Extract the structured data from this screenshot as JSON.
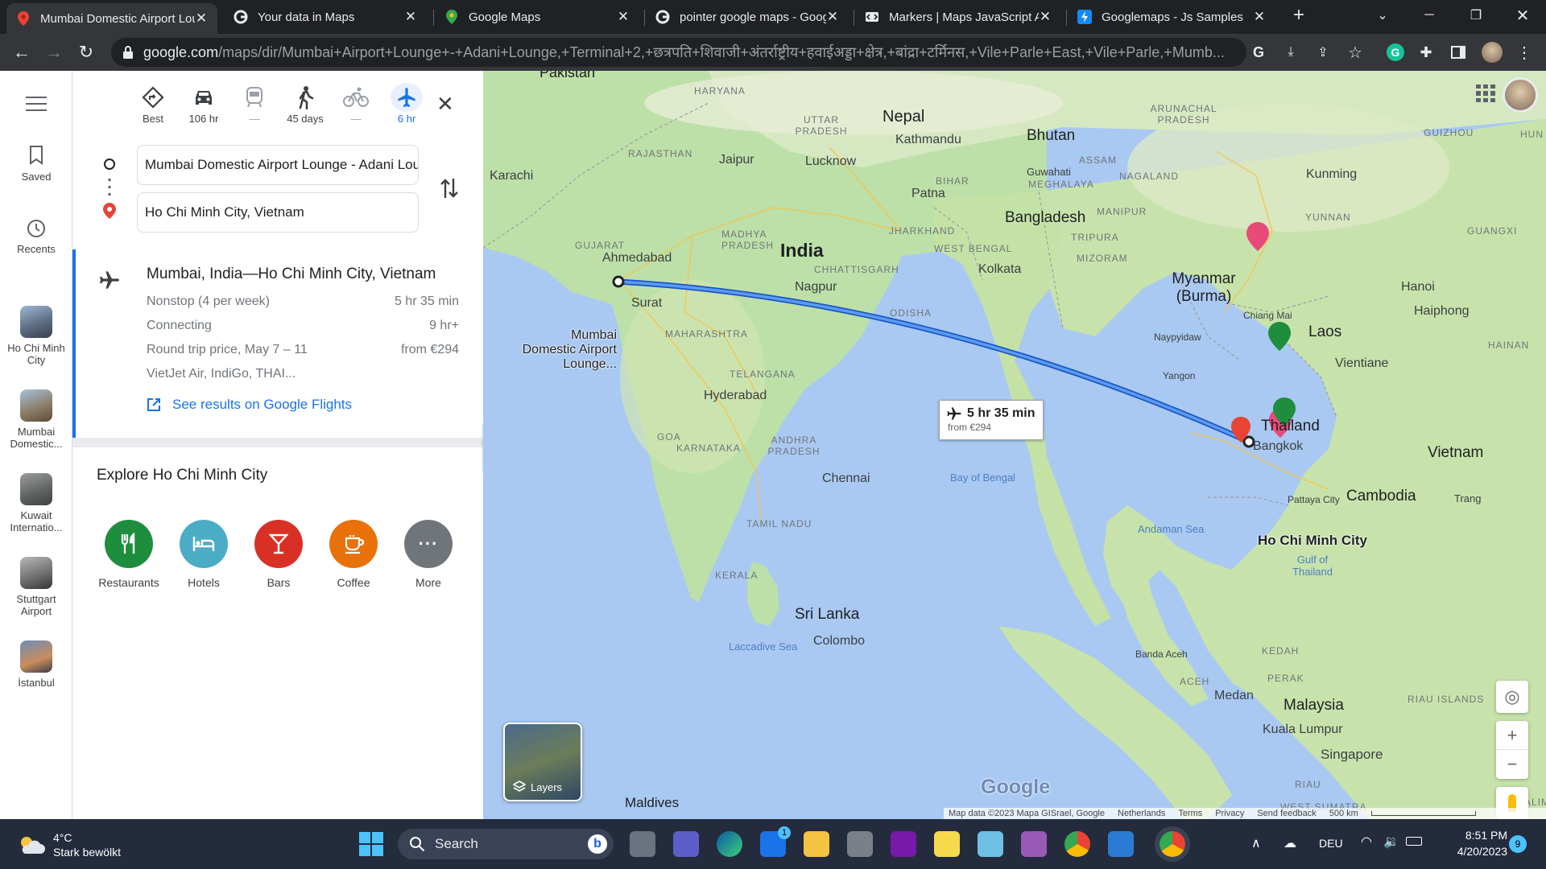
{
  "browser": {
    "tabs": [
      {
        "title": "Mumbai Domestic Airport Lounge - Adani",
        "icon": "google-maps-icon",
        "active": true
      },
      {
        "title": "Your data in Maps",
        "icon": "google-icon",
        "active": false
      },
      {
        "title": "Google Maps",
        "icon": "google-maps-icon",
        "active": false
      },
      {
        "title": "pointer google maps - Google Search",
        "icon": "google-icon",
        "active": false
      },
      {
        "title": "Markers | Maps JavaScript API",
        "icon": "google-dev-icon",
        "active": false
      },
      {
        "title": "Googlemaps - Js Samples",
        "icon": "bolt-icon",
        "active": false
      }
    ],
    "new_tab": "+",
    "url_host": "google.com",
    "url_path": "/maps/dir/Mumbai+Airport+Lounge+-+Adani+Lounge,+Terminal+2,+छत्रपति+शिवाजी+अंतर्राष्ट्रीय+हवाईअड्डा+क्षेत्र,+बांद्रा+टर्मिनस,+Vile+Parle+East,+Vile+Parle,+Mumb..."
  },
  "rail": {
    "items": [
      {
        "label": "Saved",
        "icon": "bookmark-icon"
      },
      {
        "label": "Recents",
        "icon": "history-icon"
      },
      {
        "label": "Ho Chi Minh City",
        "icon": "place-thumbnail"
      },
      {
        "label": "Mumbai Domestic...",
        "icon": "place-thumbnail"
      },
      {
        "label": "Kuwait Internatio...",
        "icon": "place-thumbnail"
      },
      {
        "label": "Stuttgart Airport",
        "icon": "place-thumbnail"
      },
      {
        "label": "İstanbul",
        "icon": "place-thumbnail"
      }
    ]
  },
  "directions": {
    "modes": [
      {
        "label": "Best",
        "icon": "best-route-icon"
      },
      {
        "label": "106 hr",
        "icon": "car-icon"
      },
      {
        "label": "—",
        "icon": "transit-icon"
      },
      {
        "label": "45 days",
        "icon": "walk-icon"
      },
      {
        "label": "—",
        "icon": "bike-icon"
      },
      {
        "label": "6 hr",
        "icon": "flight-icon"
      }
    ],
    "origin": "Mumbai Domestic Airport Lounge - Adani Lounge",
    "destination": "Ho Chi Minh City, Vietnam"
  },
  "flight_result": {
    "title": "Mumbai, India—Ho Chi Minh City, Vietnam",
    "rows": [
      {
        "label": "Nonstop (4 per week)",
        "value": "5 hr 35 min"
      },
      {
        "label": "Connecting",
        "value": "9 hr+"
      },
      {
        "label": "Round trip price, May 7 – 11",
        "value": "from €294"
      }
    ],
    "airlines": "VietJet Air, IndiGo, THAI...",
    "link": "See results on Google Flights"
  },
  "explore": {
    "title": "Explore Ho Chi Minh City",
    "categories": [
      {
        "label": "Restaurants",
        "color": "#1e8e3e",
        "icon": "fork-knife-icon"
      },
      {
        "label": "Hotels",
        "color": "#4bacc6",
        "icon": "bed-icon"
      },
      {
        "label": "Bars",
        "color": "#d93025",
        "icon": "cocktail-icon"
      },
      {
        "label": "Coffee",
        "color": "#e8710a",
        "icon": "coffee-icon"
      },
      {
        "label": "More",
        "color": "#70757a",
        "icon": "more-dots-icon"
      }
    ]
  },
  "map": {
    "flight_badge": {
      "duration": "5 hr 35 min",
      "price": "from €294"
    },
    "origin_label": "Mumbai Domestic Airport Lounge...",
    "destination_label": "Ho Chi Minh City",
    "countries": [
      "Pakistan",
      "Nepal",
      "Bhutan",
      "India",
      "Bangladesh",
      "Myanmar (Burma)",
      "Laos",
      "Thailand",
      "Vietnam",
      "Cambodia",
      "Sri Lanka",
      "Malaysia",
      "Maldives"
    ],
    "cities": [
      "Karachi",
      "Jaipur",
      "Lucknow",
      "Kathmandu",
      "Patna",
      "Ahmedabad",
      "Surat",
      "Nagpur",
      "Kolkata",
      "Hyderabad",
      "Chennai",
      "Colombo",
      "Kunming",
      "Hanoi",
      "Haiphong",
      "Vientiane",
      "Bangkok",
      "Yangon",
      "Naypyidaw",
      "Chiang Mai",
      "Pattaya City",
      "Trang",
      "Medan",
      "Kuala Lumpur",
      "Singapore",
      "Guwahati",
      "Banda Aceh"
    ],
    "regions": [
      "HARYANA",
      "UTTAR PRADESH",
      "RAJASTHAN",
      "BIHAR",
      "ARUNACHAL PRADESH",
      "ASSAM",
      "MEGHALAYA",
      "NAGALAND",
      "MANIPUR",
      "TRIPURA",
      "MIZORAM",
      "JHARKHAND",
      "WEST BENGAL",
      "GUJARAT",
      "MADHYA PRADESH",
      "CHHATTISGARH",
      "ODISHA",
      "MAHARASHTRA",
      "TELANGANA",
      "GOA",
      "KARNATAKA",
      "ANDHRA PRADESH",
      "TAMIL NADU",
      "KERALA",
      "YUNNAN",
      "GUIZHOU",
      "GUANGXI",
      "HAINAN",
      "KEDAH",
      "PERAK",
      "ACEH",
      "RIAU",
      "RIAU ISLANDS",
      "WEST SUMATRA",
      "HUN",
      "KALIMAN"
    ],
    "water": [
      "Bay of Bengal",
      "Andaman Sea",
      "Gulf of Thailand",
      "Laccadive Sea"
    ],
    "layers": "Layers",
    "logo": "Google",
    "attribution": [
      "Map data ©2023 Mapa GISrael, Google",
      "Netherlands",
      "Terms",
      "Privacy",
      "Send feedback",
      "500 km"
    ]
  },
  "taskbar": {
    "weather_temp": "4°C",
    "weather_desc": "Stark bewölkt",
    "search": "Search",
    "lang": "DEU",
    "time": "8:51 PM",
    "date": "4/20/2023",
    "notif": "9",
    "mail_badge": "1"
  }
}
